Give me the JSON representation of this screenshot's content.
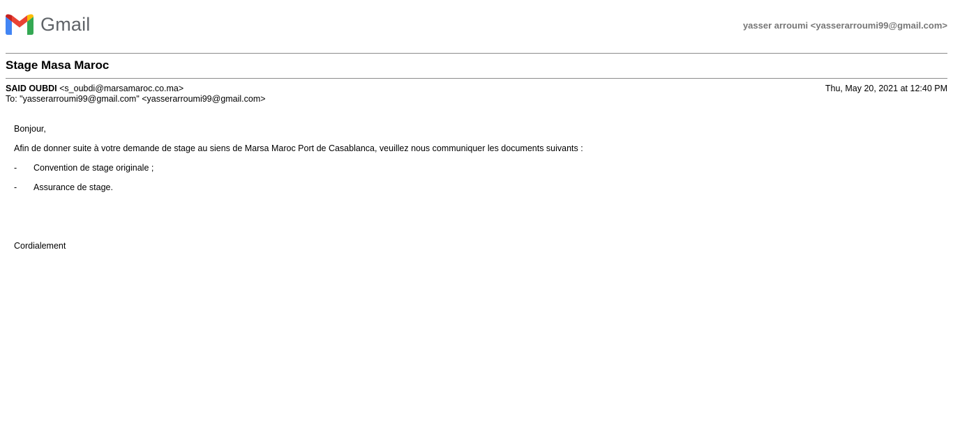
{
  "app": {
    "logo_text": "Gmail",
    "account": "yasser arroumi <yasserarroumi99@gmail.com>"
  },
  "email": {
    "subject": "Stage Masa Maroc",
    "sender_name": "SAID OUBDI",
    "sender_email": "<s_oubdi@marsamaroc.co.ma>",
    "date": "Thu, May 20, 2021 at 12:40 PM",
    "to": "To: \"yasserarroumi99@gmail.com\" <yasserarroumi99@gmail.com>",
    "body": {
      "greeting": "Bonjour,",
      "intro": "Afin de donner suite à votre demande de stage au siens de Marsa Maroc Port de Casablanca, veuillez nous communiquer les documents suivants :",
      "bullets": [
        {
          "dash": "-",
          "text": "Convention de stage originale ;"
        },
        {
          "dash": "-",
          "text": "Assurance de stage."
        }
      ],
      "closing": "Cordialement"
    }
  },
  "colors": {
    "gmail_red": "#EA4335",
    "gmail_blue": "#4285F4",
    "gmail_green": "#34A853",
    "gmail_yellow": "#FBBC04",
    "gmail_dark_red": "#C5221F"
  }
}
